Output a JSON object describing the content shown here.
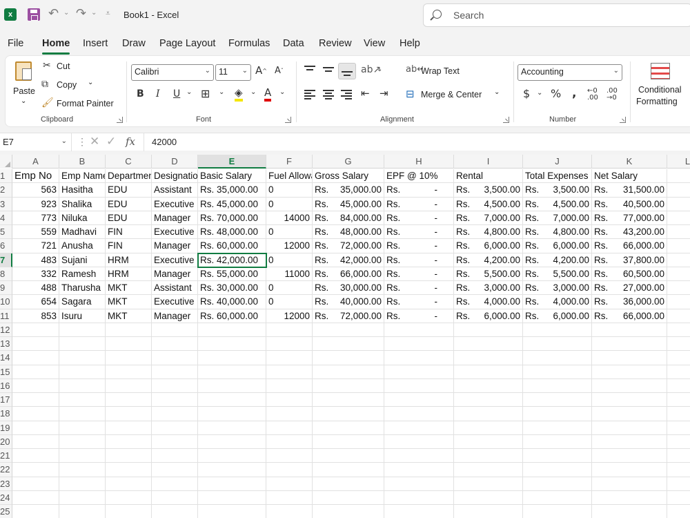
{
  "titlebar": {
    "title": "Book1  -  Excel",
    "search_placeholder": "Search"
  },
  "menu": [
    "File",
    "Home",
    "Insert",
    "Draw",
    "Page Layout",
    "Formulas",
    "Data",
    "Review",
    "View",
    "Help"
  ],
  "ribbon": {
    "clipboard": {
      "paste": "Paste",
      "cut": "Cut",
      "copy": "Copy",
      "format_painter": "Format Painter",
      "label": "Clipboard"
    },
    "font": {
      "font_name": "Calibri",
      "font_size": "11",
      "label": "Font"
    },
    "alignment": {
      "wrap_text": "Wrap Text",
      "merge_center": "Merge & Center",
      "label": "Alignment"
    },
    "number": {
      "format": "Accounting",
      "label": "Number"
    },
    "styles": {
      "conditional_line1": "Conditional",
      "conditional_line2": "Formatting"
    }
  },
  "formula_bar": {
    "name_box": "E7",
    "formula": "42000"
  },
  "sheet": {
    "columns": [
      "A",
      "B",
      "C",
      "D",
      "E",
      "F",
      "G",
      "H",
      "I",
      "J",
      "K",
      "L"
    ],
    "selected_column": "E",
    "selected_row": 7,
    "row_numbers": [
      "1",
      "2",
      "3",
      "4",
      "5",
      "6",
      "7",
      "8",
      "9",
      "10",
      "11",
      "12",
      "13",
      "14",
      "15",
      "16",
      "17",
      "18",
      "19",
      "20",
      "21",
      "22",
      "23",
      "24",
      "25"
    ],
    "headers": [
      "Emp No",
      "Emp Name",
      "Department",
      "Designation",
      "Basic Salary",
      "Fuel Allowance",
      "Gross Salary",
      "EPF @ 10%",
      "Rental",
      "Total Expenses",
      "Net Salary"
    ],
    "rows": [
      [
        "563",
        "Hasitha",
        "EDU",
        "Assistant",
        "Rs. 35,000.00",
        "0",
        "35,000.00",
        "-",
        "3,500.00",
        "3,500.00",
        "31,500.00"
      ],
      [
        "923",
        "Shalika",
        "EDU",
        "Executive",
        "Rs. 45,000.00",
        "0",
        "45,000.00",
        "-",
        "4,500.00",
        "4,500.00",
        "40,500.00"
      ],
      [
        "773",
        "Niluka",
        "EDU",
        "Manager",
        "Rs. 70,000.00",
        "14000",
        "84,000.00",
        "-",
        "7,000.00",
        "7,000.00",
        "77,000.00"
      ],
      [
        "559",
        "Madhavi",
        "FIN",
        "Executive",
        "Rs. 48,000.00",
        "0",
        "48,000.00",
        "-",
        "4,800.00",
        "4,800.00",
        "43,200.00"
      ],
      [
        "721",
        "Anusha",
        "FIN",
        "Manager",
        "Rs. 60,000.00",
        "12000",
        "72,000.00",
        "-",
        "6,000.00",
        "6,000.00",
        "66,000.00"
      ],
      [
        "483",
        "Sujani",
        "HRM",
        "Executive",
        "Rs. 42,000.00",
        "0",
        "42,000.00",
        "-",
        "4,200.00",
        "4,200.00",
        "37,800.00"
      ],
      [
        "332",
        "Ramesh",
        "HRM",
        "Manager",
        "Rs. 55,000.00",
        "11000",
        "66,000.00",
        "-",
        "5,500.00",
        "5,500.00",
        "60,500.00"
      ],
      [
        "488",
        "Tharusha",
        "MKT",
        "Assistant",
        "Rs. 30,000.00",
        "0",
        "30,000.00",
        "-",
        "3,000.00",
        "3,000.00",
        "27,000.00"
      ],
      [
        "654",
        "Sagara",
        "MKT",
        "Executive",
        "Rs. 40,000.00",
        "0",
        "40,000.00",
        "-",
        "4,000.00",
        "4,000.00",
        "36,000.00"
      ],
      [
        "853",
        "Isuru",
        "MKT",
        "Manager",
        "Rs. 60,000.00",
        "12000",
        "72,000.00",
        "-",
        "6,000.00",
        "6,000.00",
        "66,000.00"
      ]
    ],
    "currency_prefix": "Rs."
  }
}
